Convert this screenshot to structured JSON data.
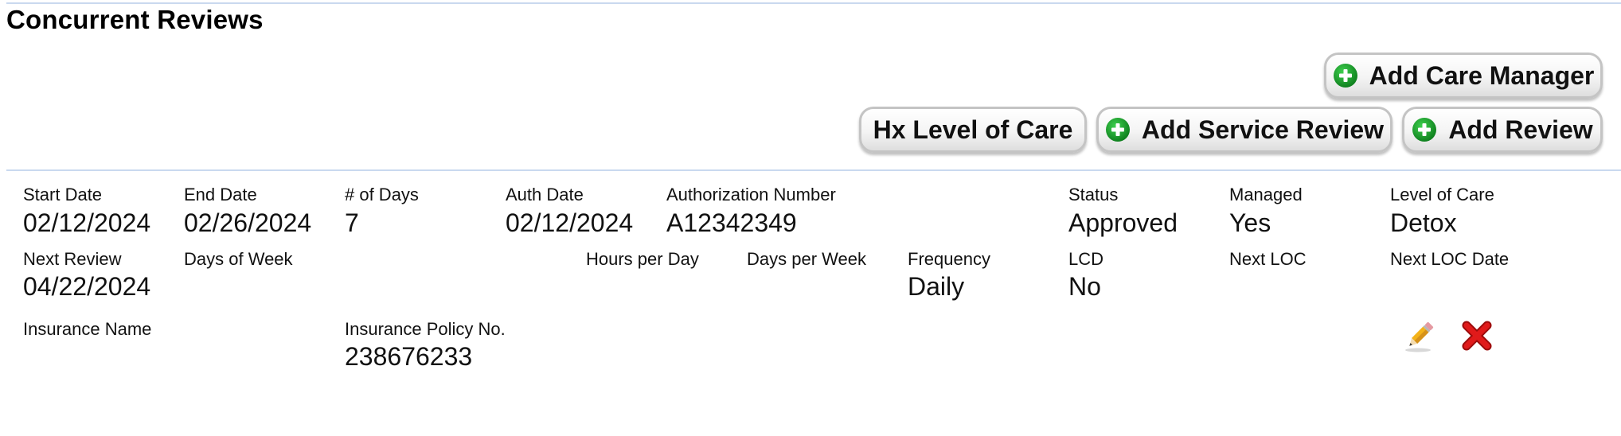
{
  "section": {
    "title": "Concurrent Reviews"
  },
  "buttons": {
    "add_care_manager": "Add Care Manager",
    "hx_level_of_care": "Hx Level of Care",
    "add_service_review": "Add Service Review",
    "add_review": "Add Review"
  },
  "review": {
    "start_date": {
      "label": "Start Date",
      "value": "02/12/2024"
    },
    "end_date": {
      "label": "End Date",
      "value": "02/26/2024"
    },
    "num_days": {
      "label": "# of Days",
      "value": "7"
    },
    "auth_date": {
      "label": "Auth Date",
      "value": "02/12/2024"
    },
    "auth_number": {
      "label": "Authorization Number",
      "value": "A12342349"
    },
    "status": {
      "label": "Status",
      "value": "Approved"
    },
    "managed": {
      "label": "Managed",
      "value": "Yes"
    },
    "level_of_care": {
      "label": "Level of Care",
      "value": "Detox"
    },
    "next_review": {
      "label": "Next Review",
      "value": "04/22/2024"
    },
    "days_of_week": {
      "label": "Days of Week",
      "value": ""
    },
    "hours_per_day": {
      "label": "Hours per Day",
      "value": ""
    },
    "days_per_week": {
      "label": "Days per Week",
      "value": ""
    },
    "frequency": {
      "label": "Frequency",
      "value": "Daily"
    },
    "lcd": {
      "label": "LCD",
      "value": "No"
    },
    "next_loc": {
      "label": "Next LOC",
      "value": ""
    },
    "next_loc_date": {
      "label": "Next LOC Date",
      "value": ""
    },
    "insurance_name": {
      "label": "Insurance Name",
      "value": ""
    },
    "insurance_policy": {
      "label": "Insurance Policy No.",
      "value": "238676233"
    }
  },
  "icons": {
    "plus": "plus-circle-icon",
    "edit": "pencil-icon",
    "delete": "red-x-icon"
  },
  "colors": {
    "plus_green": "#1c9e2b",
    "delete_red": "#d51010",
    "rule": "#c9d9ef"
  }
}
